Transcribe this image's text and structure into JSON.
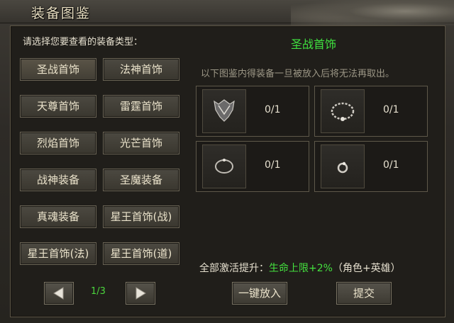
{
  "window": {
    "title": "装备图鉴"
  },
  "left": {
    "prompt": "请选择您要查看的装备类型：",
    "categories": [
      "圣战首饰",
      "法神首饰",
      "天尊首饰",
      "雷霆首饰",
      "烈焰首饰",
      "光芒首饰",
      "战神装备",
      "圣魔装备",
      "真魂装备",
      "星王首饰(战)",
      "星王首饰(法)",
      "星王首饰(道)"
    ],
    "pager": {
      "page": "1/3",
      "prev_icon": "arrow-left-icon",
      "next_icon": "arrow-right-icon"
    }
  },
  "right": {
    "title": "圣战首饰",
    "notice": "以下图鉴内得装备一旦被放入后将无法再取出。",
    "slots": [
      {
        "icon": "helmet-icon",
        "count": "0/1"
      },
      {
        "icon": "necklace-icon",
        "count": "0/1"
      },
      {
        "icon": "bracelet-icon",
        "count": "0/1"
      },
      {
        "icon": "ring-icon",
        "count": "0/1"
      }
    ],
    "bonus": {
      "prefix": "全部激活提升：",
      "highlight": "生命上限+2%",
      "suffix": "（角色+英雄）"
    },
    "buttons": {
      "put_all": "一键放入",
      "submit": "提交"
    }
  },
  "colors": {
    "accent_green": "#3fe23f",
    "text": "#e6e0cf",
    "muted": "#9c9786"
  }
}
